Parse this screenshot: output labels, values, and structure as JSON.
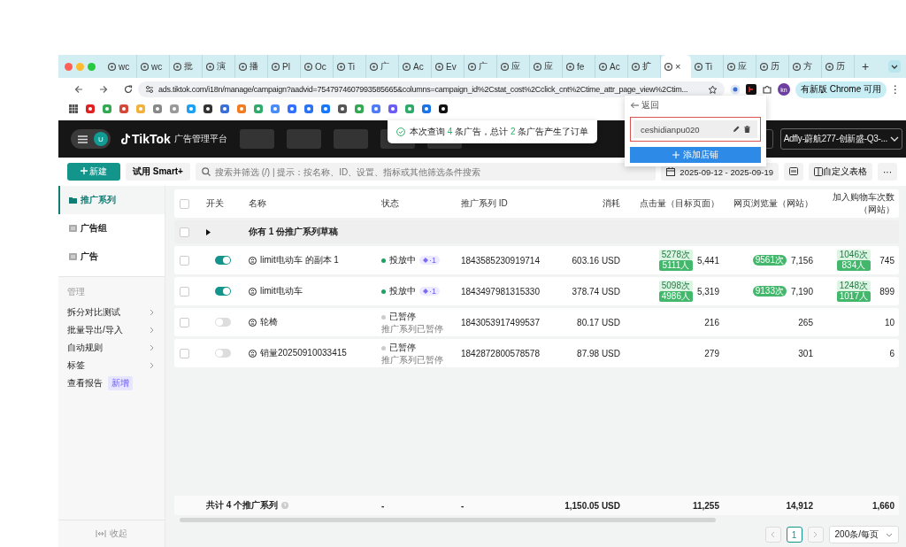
{
  "browser": {
    "tabs": [
      {
        "label": "wc",
        "selected": false
      },
      {
        "label": "wc",
        "selected": false
      },
      {
        "label": "批",
        "selected": false
      },
      {
        "label": "演",
        "selected": false
      },
      {
        "label": "播",
        "selected": false
      },
      {
        "label": "Pl",
        "selected": false
      },
      {
        "label": "Oc",
        "selected": false
      },
      {
        "label": "Ti",
        "selected": false
      },
      {
        "label": "广",
        "selected": false
      },
      {
        "label": "Ac",
        "selected": false
      },
      {
        "label": "Ev",
        "selected": false
      },
      {
        "label": "广",
        "selected": false
      },
      {
        "label": "应",
        "selected": false
      },
      {
        "label": "应",
        "selected": false
      },
      {
        "label": "fe",
        "selected": false
      },
      {
        "label": "Ac",
        "selected": false
      },
      {
        "label": "扩",
        "selected": false
      },
      {
        "close": "×",
        "selected": true
      },
      {
        "label": "Ti",
        "selected": false
      },
      {
        "label": "应",
        "selected": false
      },
      {
        "label": "历",
        "selected": false
      },
      {
        "label": "方",
        "selected": false
      },
      {
        "label": "历",
        "selected": false
      }
    ],
    "new_tab": "+",
    "address": "ads.tiktok.com/i18n/manage/campaign?aadvid=7547974607993585665&columns=campaign_id%2Cstat_cost%2Cclick_cnt%2Ctime_attr_page_view%2Ctim...",
    "profile": "kn",
    "update_button": "有新版 Chrome 可用",
    "menu": "⋮"
  },
  "header": {
    "avatar": "U",
    "logo": "TikTok",
    "product": "广告管理平台",
    "account": "Adfly-蔚航277-创新盛-Q3-..."
  },
  "toast": {
    "text": "本次查询 **4** 条广告，总计 **2** 条广告产生了订单"
  },
  "popover": {
    "back": "返回",
    "stores": [
      {
        "name": "ceshidianpu020",
        "highlighted": true
      }
    ],
    "add_button": "添加店铺"
  },
  "toolbar": {
    "new_button": "新建",
    "smart_button": "试用 Smart+",
    "search_placeholder": "搜索并筛选 (/) | 提示：按名称、ID、设置、指标或其他筛选条件搜索",
    "date_range": "2025-09-12 - 2025-09-19",
    "customize_button": "自定义表格",
    "more": "···"
  },
  "sidebar": {
    "items": [
      {
        "kind": "nav",
        "label": "推广系列",
        "selected": true
      },
      {
        "kind": "nav",
        "label": "广告组",
        "selected": false
      },
      {
        "kind": "nav",
        "label": "广告",
        "selected": false
      },
      {
        "kind": "heading",
        "label": "管理"
      },
      {
        "kind": "submenu",
        "label": "拆分对比测试"
      },
      {
        "kind": "submenu",
        "label": "批量导出/导入"
      },
      {
        "kind": "submenu",
        "label": "自动规则"
      },
      {
        "kind": "submenu",
        "label": "标签"
      },
      {
        "kind": "link",
        "label": "查看报告",
        "badge": "新增"
      }
    ],
    "collapse": "收起"
  },
  "table": {
    "header_checked": false,
    "columns": [
      "开关",
      "名称",
      "状态",
      "推广系列 ID",
      "消耗",
      "点击量（目标页面）",
      "网页浏览量（网站）",
      "加入购物车次数（网站）"
    ],
    "draft": {
      "text": "你有 1 份推广系列草稿",
      "checked": false,
      "expanded": false
    },
    "rows": [
      {
        "checked": false,
        "enabled": true,
        "name": "limit电动车 的副本 1",
        "status": {
          "label": "投放中",
          "active": true,
          "tag": "·1"
        },
        "id": "1843585230919714",
        "cost": "603.16 USD",
        "metrics": [
          {
            "value": "5,441",
            "badges": [
              {
                "text": "5278次",
                "solid": false
              },
              {
                "text": "5111人",
                "solid": true
              }
            ]
          },
          {
            "value": "7,156",
            "badges": [
              {
                "text": "9561次",
                "solid": true
              }
            ]
          },
          {
            "value": "745",
            "badges": [
              {
                "text": "1046次",
                "solid": false
              },
              {
                "text": "834人",
                "solid": true
              }
            ]
          }
        ]
      },
      {
        "checked": false,
        "enabled": true,
        "name": "limit电动车",
        "status": {
          "label": "投放中",
          "active": true,
          "tag": "·1"
        },
        "id": "1843497981315330",
        "cost": "378.74 USD",
        "metrics": [
          {
            "value": "5,319",
            "badges": [
              {
                "text": "5098次",
                "solid": false
              },
              {
                "text": "4986人",
                "solid": true
              }
            ]
          },
          {
            "value": "7,190",
            "badges": [
              {
                "text": "9133次",
                "solid": true
              }
            ]
          },
          {
            "value": "899",
            "badges": [
              {
                "text": "1248次",
                "solid": false
              },
              {
                "text": "1017人",
                "solid": true
              }
            ]
          }
        ]
      },
      {
        "checked": false,
        "enabled": false,
        "name": "轮椅",
        "status": {
          "label": "已暂停",
          "active": false,
          "note": "推广系列已暂停"
        },
        "id": "1843053917499537",
        "cost": "80.17 USD",
        "metrics": [
          {
            "value": "216"
          },
          {
            "value": "265"
          },
          {
            "value": "10"
          }
        ]
      },
      {
        "checked": false,
        "enabled": false,
        "name": "销量20250910033415",
        "status": {
          "label": "已暂停",
          "active": false,
          "note": "推广系列已暂停"
        },
        "id": "1842872800578578",
        "cost": "87.98 USD",
        "metrics": [
          {
            "value": "279"
          },
          {
            "value": "301"
          },
          {
            "value": "6"
          }
        ]
      }
    ],
    "total": {
      "label": "共计 4 个推广系列",
      "cells": [
        "-",
        "-",
        "1,150.05 USD",
        "11,255",
        "14,912",
        "1,660"
      ]
    }
  },
  "pagination": {
    "pages": [
      {
        "label": "1",
        "selected": true
      }
    ],
    "page_size": "200条/每页"
  }
}
